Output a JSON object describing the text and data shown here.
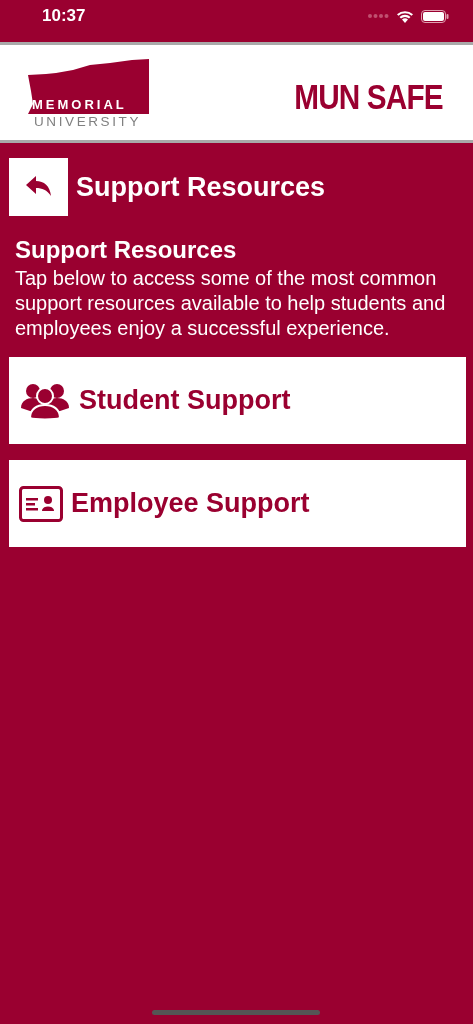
{
  "status_bar": {
    "time": "10:37"
  },
  "header": {
    "logo_top": "MEMORIAL",
    "logo_bottom": "UNIVERSITY",
    "app_name": "MUN SAFE"
  },
  "nav": {
    "title": "Support Resources"
  },
  "intro": {
    "heading": "Support Resources",
    "text": "Tap below to access some of the most common support resources available to help students and employees enjoy a successful experience."
  },
  "items": [
    {
      "label": "Student Support",
      "kind": "group"
    },
    {
      "label": "Employee Support",
      "kind": "id-card"
    }
  ]
}
